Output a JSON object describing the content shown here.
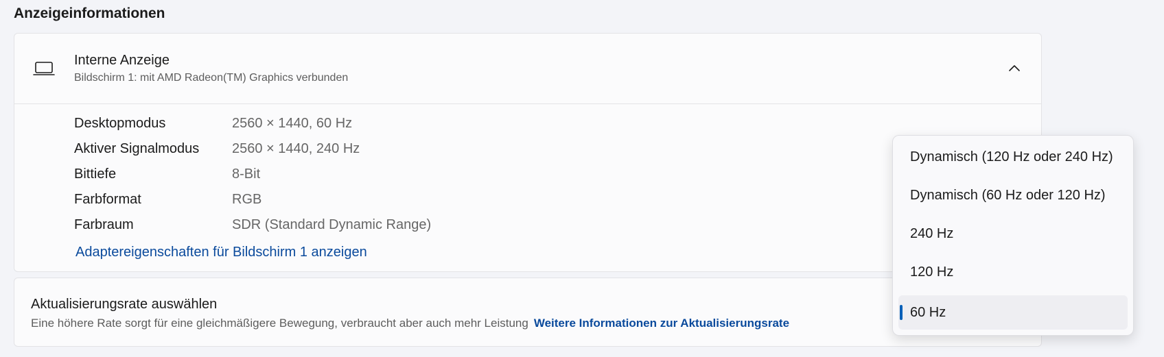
{
  "section": {
    "title": "Anzeigeinformationen"
  },
  "display": {
    "name": "Interne Anzeige",
    "subtitle": "Bildschirm 1: mit AMD Radeon(TM) Graphics verbunden",
    "rows": [
      {
        "label": "Desktopmodus",
        "value": "2560 × 1440, 60 Hz"
      },
      {
        "label": "Aktiver Signalmodus",
        "value": "2560 × 1440, 240 Hz"
      },
      {
        "label": "Bittiefe",
        "value": "8-Bit"
      },
      {
        "label": "Farbformat",
        "value": "RGB"
      },
      {
        "label": "Farbraum",
        "value": "SDR (Standard Dynamic Range)"
      }
    ],
    "adapter_link": "Adaptereigenschaften für Bildschirm 1 anzeigen"
  },
  "refresh_rate": {
    "title": "Aktualisierungsrate auswählen",
    "description": "Eine höhere Rate sorgt für eine gleichmäßigere Bewegung, verbraucht aber auch mehr Leistung",
    "more_info_link": "Weitere Informationen zur Aktualisierungsrate"
  },
  "dropdown": {
    "options": [
      "Dynamisch (120 Hz oder 240 Hz)",
      "Dynamisch (60 Hz oder 120 Hz)",
      "240 Hz",
      "120 Hz",
      "60 Hz"
    ],
    "selected": "60 Hz"
  },
  "colors": {
    "accent": "#005fb8",
    "link": "#0a4a9c",
    "background": "#f3f4f8",
    "card": "#fbfbfc"
  },
  "icons": {
    "display": "laptop-icon",
    "collapse": "chevron-up-icon"
  }
}
